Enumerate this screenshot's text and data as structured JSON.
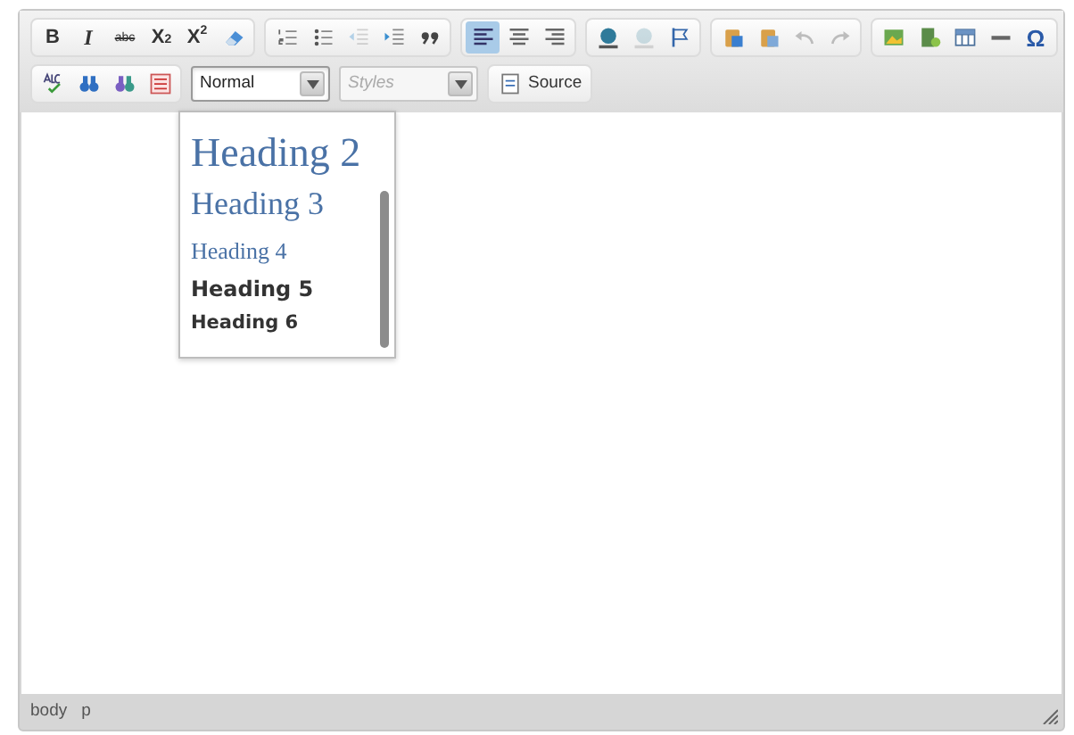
{
  "toolbar": {
    "rows": [
      {
        "groups": [
          {
            "buttons": [
              {
                "kind": "bold",
                "label": "B"
              },
              {
                "kind": "italic",
                "label": "I"
              },
              {
                "kind": "strike",
                "label": "abc"
              },
              {
                "kind": "subscript",
                "label": "X$_{2}$"
              },
              {
                "kind": "superscript",
                "label": "X$^{2}$"
              },
              {
                "kind": "eraser"
              }
            ]
          },
          {
            "buttons": [
              {
                "kind": "numbered-list"
              },
              {
                "kind": "bullet-list"
              },
              {
                "kind": "outdent",
                "disabled": true
              },
              {
                "kind": "indent"
              },
              {
                "kind": "quote"
              }
            ]
          },
          {
            "buttons": [
              {
                "kind": "align-left",
                "active": true
              },
              {
                "kind": "align-center"
              },
              {
                "kind": "align-right"
              }
            ]
          },
          {
            "buttons": [
              {
                "kind": "link"
              },
              {
                "kind": "unlink",
                "disabled": true
              },
              {
                "kind": "flag"
              }
            ]
          },
          {
            "buttons": [
              {
                "kind": "paste-text"
              },
              {
                "kind": "paste-word"
              },
              {
                "kind": "undo",
                "disabled": true
              },
              {
                "kind": "redo",
                "disabled": true
              }
            ]
          },
          {
            "buttons": [
              {
                "kind": "image"
              },
              {
                "kind": "flash"
              },
              {
                "kind": "table"
              },
              {
                "kind": "rule"
              },
              {
                "kind": "omega",
                "label": "Ω"
              }
            ]
          }
        ]
      },
      {
        "groups": [
          {
            "buttons": [
              {
                "kind": "spellcheck"
              },
              {
                "kind": "find"
              },
              {
                "kind": "replace"
              },
              {
                "kind": "select-all"
              }
            ]
          },
          {
            "buttons": [
              {
                "kind": "combo",
                "value": "Normal",
                "expanded": true
              }
            ]
          },
          {
            "buttons": [
              {
                "kind": "combo",
                "placeholder": "Styles",
                "disabled": true
              }
            ]
          },
          {
            "buttons": [
              {
                "kind": "source",
                "label": "Source"
              }
            ]
          }
        ]
      }
    ]
  },
  "format_menu": {
    "items": [
      {
        "kind": "h2",
        "label": "Heading 2"
      },
      {
        "kind": "h3",
        "label": "Heading 3"
      },
      {
        "kind": "h4",
        "label": "Heading 4"
      },
      {
        "kind": "h5",
        "label": "Heading 5"
      },
      {
        "kind": "h6",
        "label": "Heading 6"
      }
    ]
  },
  "status_bar": {
    "path": [
      "body",
      "p"
    ]
  }
}
